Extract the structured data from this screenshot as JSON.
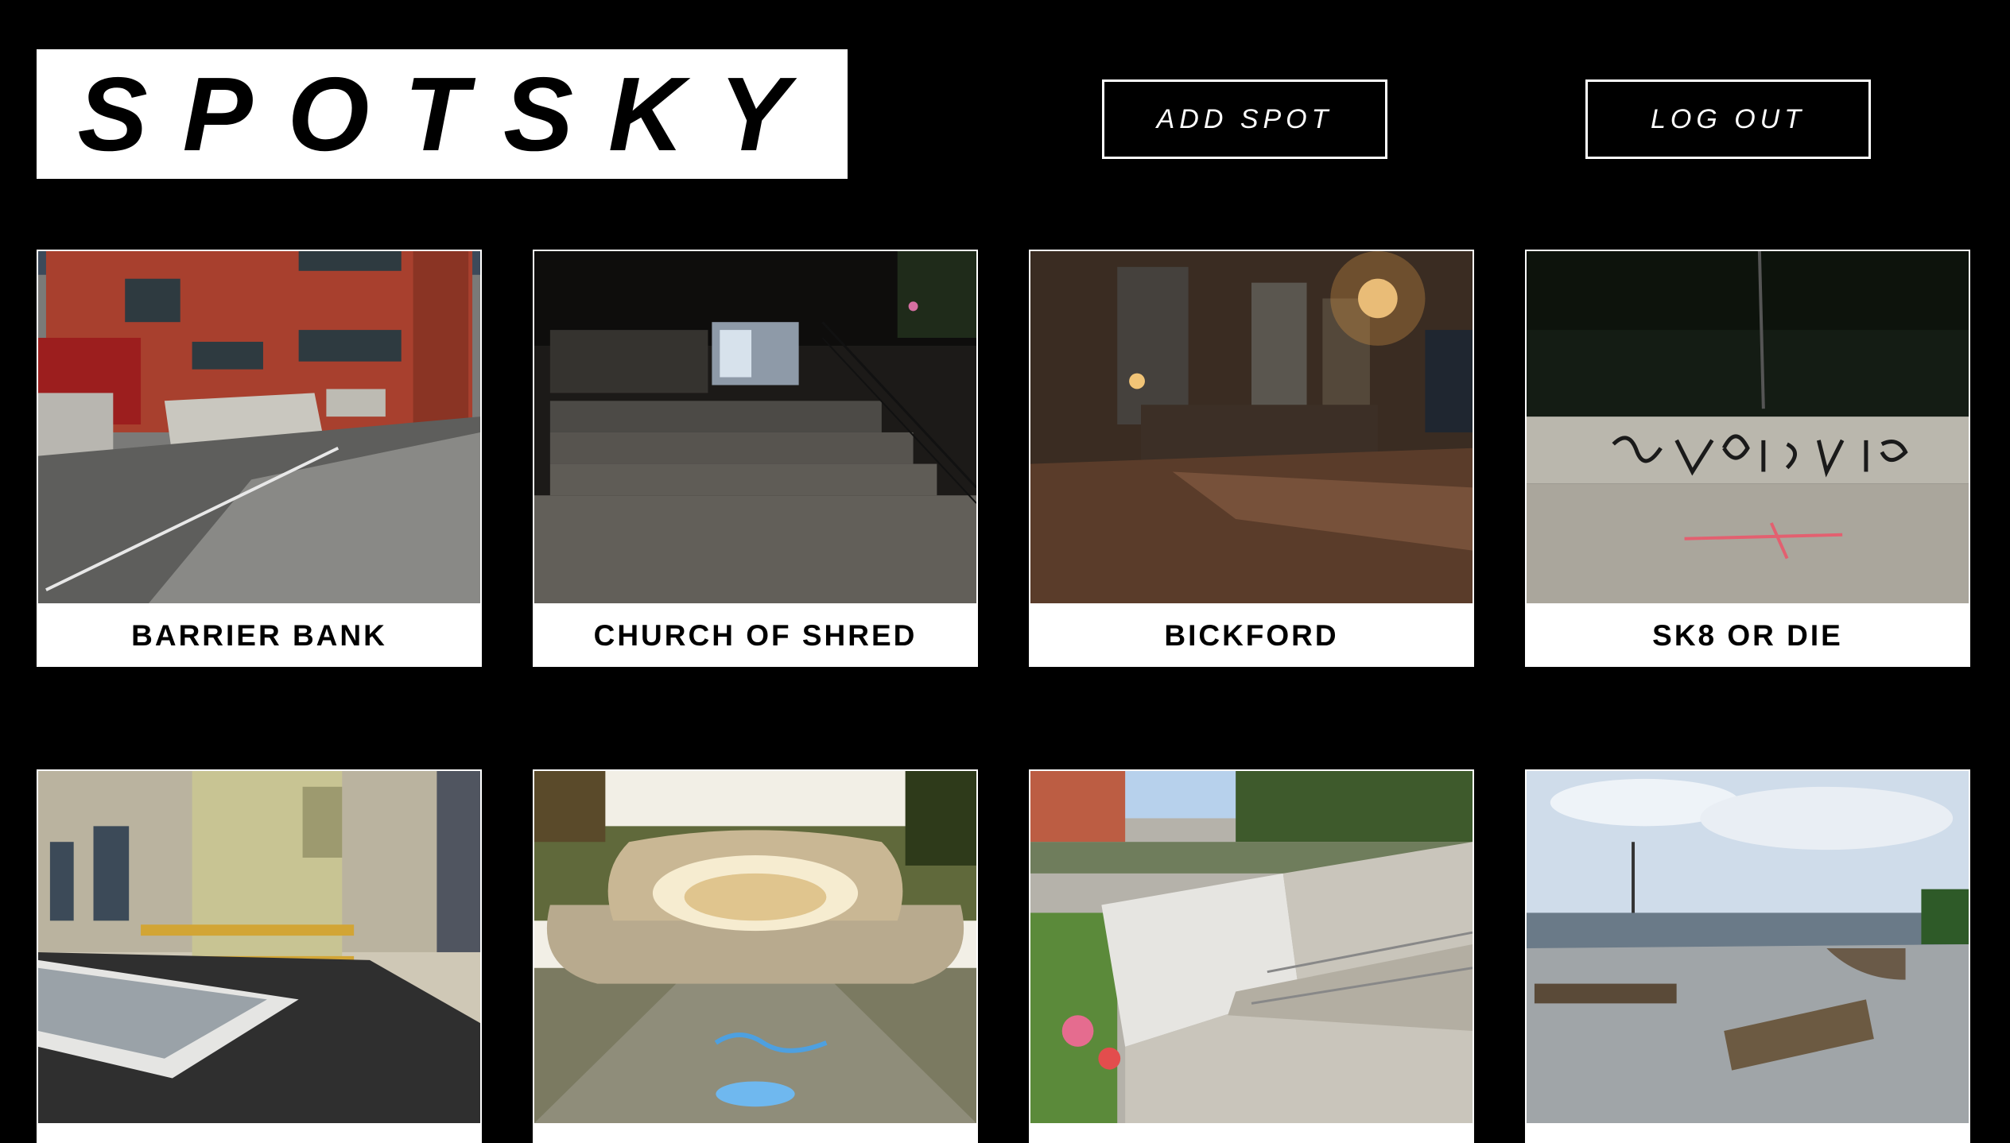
{
  "header": {
    "logo_text": "SPOTSKY",
    "add_spot_label": "ADD SPOT",
    "log_out_label": "LOG OUT"
  },
  "spots": [
    {
      "name": "BARRIER BANK"
    },
    {
      "name": "CHURCH OF SHRED"
    },
    {
      "name": "BICKFORD"
    },
    {
      "name": "SK8 OR DIE"
    },
    {
      "name": ""
    },
    {
      "name": ""
    },
    {
      "name": ""
    },
    {
      "name": ""
    }
  ],
  "colors": {
    "background": "#000000",
    "card": "#ffffff",
    "text_dark": "#000000",
    "text_light": "#ffffff"
  }
}
